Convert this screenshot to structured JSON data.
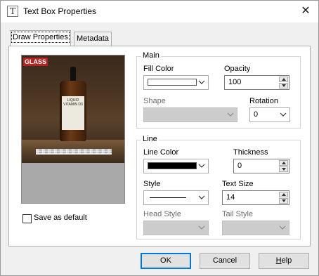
{
  "window": {
    "title": "Text Box Properties",
    "app_icon_glyph": "T",
    "close_glyph": "✕"
  },
  "tabs": [
    {
      "label": "Draw Properties",
      "active": true
    },
    {
      "label": "Metadata",
      "active": false
    }
  ],
  "preview": {
    "sign_text": "GLASS",
    "bottle_label_text": "LIQUID VITAMIN D3",
    "textbox_text": "░▒░▒░▒░▒░▒░▒░▒░▒░▒░▒░▒░▒░▒░▒░▒░▒░▒░▒░▒░▒░"
  },
  "save_default": {
    "label": "Save as default",
    "checked": false
  },
  "main_group": {
    "title": "Main",
    "fill_color_label": "Fill Color",
    "fill_color": "#ffffff",
    "opacity_label": "Opacity",
    "opacity_value": "100",
    "shape_label": "Shape",
    "shape_value": "",
    "rotation_label": "Rotation",
    "rotation_value": "0"
  },
  "line_group": {
    "title": "Line",
    "line_color_label": "Line Color",
    "line_color": "#000000",
    "thickness_label": "Thickness",
    "thickness_value": "0",
    "style_label": "Style",
    "text_size_label": "Text Size",
    "text_size_value": "14",
    "head_style_label": "Head Style",
    "tail_style_label": "Tail Style"
  },
  "buttons": {
    "ok": "OK",
    "cancel": "Cancel",
    "help_underlined": "H",
    "help_rest": "elp"
  }
}
